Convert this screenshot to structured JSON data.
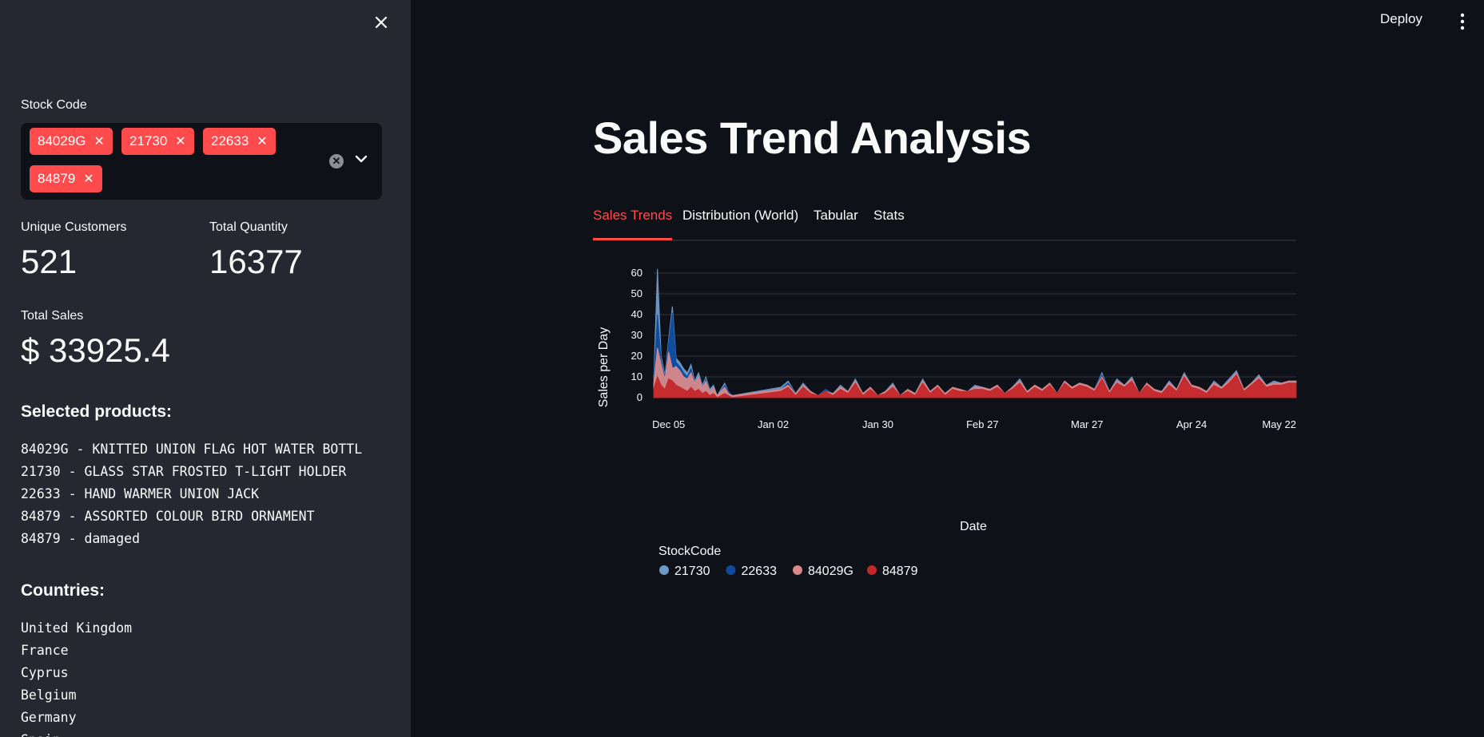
{
  "sidebar": {
    "stock_code_label": "Stock Code",
    "selected_tags": [
      "84029G",
      "21730",
      "22633",
      "84879"
    ],
    "metrics": [
      {
        "label": "Unique Customers",
        "value": "521"
      },
      {
        "label": "Total Quantity",
        "value": "16377"
      },
      {
        "label": "Total Sales",
        "value": "$ 33925.4"
      }
    ],
    "selected_products_heading": "Selected products:",
    "products": [
      "84029G - KNITTED UNION FLAG HOT WATER BOTTL",
      "21730 - GLASS STAR FROSTED T-LIGHT HOLDER",
      "22633 - HAND WARMER UNION JACK",
      "84879 - ASSORTED COLOUR BIRD ORNAMENT",
      "84879 - damaged"
    ],
    "countries_heading": "Countries:",
    "countries": [
      "United Kingdom",
      "France",
      "Cyprus",
      "Belgium",
      "Germany",
      "Spain"
    ]
  },
  "header": {
    "deploy_label": "Deploy"
  },
  "main": {
    "title": "Sales Trend Analysis",
    "tabs": [
      {
        "label": "Sales Trends",
        "active": true
      },
      {
        "label": "Distribution (World)",
        "active": false
      },
      {
        "label": "Tabular",
        "active": false
      },
      {
        "label": "Stats",
        "active": false
      }
    ]
  },
  "colors": {
    "accent": "#ff4b4b",
    "sidebar_bg": "#262730",
    "main_bg": "#0e1117"
  },
  "chart_data": {
    "type": "area",
    "xlabel": "Date",
    "ylabel": "Sales per Day",
    "legend_title": "StockCode",
    "legend_position": "bottom",
    "ylim": [
      0,
      60
    ],
    "y_ticks": [
      0,
      10,
      20,
      30,
      40,
      50,
      60
    ],
    "x_ticks": [
      "Dec 05",
      "Jan 02",
      "Jan 30",
      "Feb 27",
      "Mar 27",
      "Apr 24",
      "May 22"
    ],
    "x_tick_days": [
      0,
      28,
      56,
      84,
      112,
      140,
      168
    ],
    "x_range_days": [
      -4,
      168
    ],
    "grid": true,
    "series": [
      {
        "name": "21730",
        "color": "#6a9ac7",
        "x": [
          -4,
          -3,
          -2,
          -1,
          0,
          1,
          2,
          3,
          4,
          5,
          6,
          7,
          8,
          9,
          10,
          11,
          12,
          13,
          14,
          15,
          16,
          17,
          30,
          32,
          34,
          36,
          38,
          40,
          42,
          44,
          46,
          48,
          50,
          52,
          54,
          56,
          58,
          60,
          62,
          64,
          66,
          68,
          70,
          72,
          74,
          76,
          78,
          80,
          82,
          84,
          86,
          88,
          90,
          92,
          94,
          96,
          98,
          100,
          102,
          104,
          106,
          108,
          110,
          112,
          114,
          116,
          118,
          120,
          122,
          124,
          126,
          128,
          130,
          132,
          134,
          136,
          138,
          140,
          142,
          144,
          146,
          148,
          150,
          152,
          154,
          156,
          158,
          160,
          162,
          164,
          166,
          168
        ],
        "y": [
          9,
          62,
          20,
          11,
          28,
          44,
          19,
          17,
          14,
          12,
          16,
          8,
          12,
          6,
          10,
          4,
          6,
          1,
          4,
          7,
          3,
          1,
          5,
          8,
          2,
          7,
          3,
          1,
          4,
          2,
          6,
          3,
          9,
          2,
          5,
          1,
          3,
          7,
          1,
          4,
          2,
          9,
          3,
          6,
          2,
          5,
          4,
          3,
          6,
          5,
          4,
          6,
          2,
          5,
          9,
          3,
          6,
          4,
          7,
          2,
          8,
          5,
          7,
          6,
          4,
          12,
          3,
          9,
          6,
          10,
          2,
          7,
          4,
          3,
          8,
          4,
          12,
          6,
          5,
          3,
          8,
          5,
          9,
          13,
          4,
          7,
          11,
          6,
          8,
          7,
          8,
          8
        ]
      },
      {
        "name": "22633",
        "color": "#0b4a9e",
        "x": [
          -4,
          -3,
          -2,
          -1,
          0,
          1,
          2,
          3,
          4,
          5,
          6,
          7,
          8,
          9,
          10,
          11,
          12,
          13,
          14,
          15,
          16,
          17,
          30,
          32,
          34,
          36,
          38,
          40,
          42,
          44,
          46,
          48,
          50,
          52,
          54,
          56,
          58,
          60,
          62,
          64,
          66,
          68,
          70,
          72,
          74,
          76,
          78,
          80,
          82,
          84,
          86,
          88,
          90,
          92,
          94,
          96,
          98,
          100,
          102,
          104,
          106,
          108,
          110,
          112,
          114,
          116,
          118,
          120,
          122,
          124,
          126,
          128,
          130,
          132,
          134,
          136,
          138,
          140,
          142,
          144,
          146,
          148,
          150,
          152,
          154,
          156,
          158,
          160,
          162,
          164,
          166,
          168
        ],
        "y": [
          8,
          40,
          18,
          10,
          26,
          41,
          17,
          15,
          12,
          10,
          14,
          7,
          10,
          5,
          9,
          3,
          5,
          1,
          3,
          6,
          3,
          1,
          4,
          7,
          2,
          6,
          3,
          1,
          4,
          2,
          5,
          3,
          8,
          2,
          5,
          1,
          3,
          6,
          1,
          4,
          2,
          8,
          3,
          6,
          2,
          5,
          4,
          3,
          5,
          5,
          4,
          6,
          2,
          5,
          8,
          3,
          6,
          4,
          7,
          2,
          8,
          5,
          7,
          6,
          4,
          11,
          3,
          8,
          6,
          9,
          2,
          7,
          4,
          3,
          7,
          4,
          11,
          6,
          5,
          3,
          7,
          5,
          8,
          12,
          4,
          7,
          10,
          6,
          7,
          7,
          8,
          8
        ]
      },
      {
        "name": "84029G",
        "color": "#d8898a",
        "x": [
          -4,
          -3,
          -2,
          -1,
          0,
          1,
          2,
          3,
          4,
          5,
          6,
          7,
          8,
          9,
          10,
          11,
          12,
          13,
          14,
          15,
          16,
          17,
          30,
          32,
          34,
          36,
          38,
          40,
          42,
          44,
          46,
          48,
          50,
          52,
          54,
          56,
          58,
          60,
          62,
          64,
          66,
          68,
          70,
          72,
          74,
          76,
          78,
          80,
          82,
          84,
          86,
          88,
          90,
          92,
          94,
          96,
          98,
          100,
          102,
          104,
          106,
          108,
          110,
          112,
          114,
          116,
          118,
          120,
          122,
          124,
          126,
          128,
          130,
          132,
          134,
          136,
          138,
          140,
          142,
          144,
          146,
          148,
          150,
          152,
          154,
          156,
          158,
          160,
          162,
          164,
          166,
          168
        ],
        "y": [
          7,
          24,
          16,
          9,
          22,
          14,
          15,
          13,
          10,
          9,
          12,
          7,
          10,
          5,
          8,
          3,
          5,
          1,
          3,
          5,
          2,
          1,
          4,
          6,
          2,
          6,
          3,
          1,
          3,
          2,
          5,
          3,
          8,
          2,
          5,
          1,
          3,
          6,
          1,
          4,
          2,
          8,
          3,
          6,
          2,
          5,
          4,
          3,
          5,
          5,
          4,
          6,
          2,
          5,
          8,
          3,
          6,
          4,
          7,
          2,
          8,
          5,
          7,
          6,
          4,
          10,
          3,
          8,
          6,
          9,
          2,
          7,
          4,
          3,
          7,
          4,
          11,
          6,
          5,
          3,
          7,
          5,
          8,
          12,
          4,
          7,
          10,
          6,
          7,
          7,
          8,
          8
        ]
      },
      {
        "name": "84879",
        "color": "#c4272a",
        "x": [
          -4,
          -3,
          -2,
          -1,
          0,
          1,
          2,
          3,
          4,
          5,
          6,
          7,
          8,
          9,
          10,
          11,
          12,
          13,
          14,
          15,
          16,
          17,
          30,
          32,
          34,
          36,
          38,
          40,
          42,
          44,
          46,
          48,
          50,
          52,
          54,
          56,
          58,
          60,
          62,
          64,
          66,
          68,
          70,
          72,
          74,
          76,
          78,
          80,
          82,
          84,
          86,
          88,
          90,
          92,
          94,
          96,
          98,
          100,
          102,
          104,
          106,
          108,
          110,
          112,
          114,
          116,
          118,
          120,
          122,
          124,
          126,
          128,
          130,
          132,
          134,
          136,
          138,
          140,
          142,
          144,
          146,
          148,
          150,
          152,
          154,
          156,
          158,
          160,
          162,
          164,
          166,
          168
        ],
        "y": [
          4,
          10,
          6,
          4,
          9,
          8,
          6,
          5,
          4,
          3,
          5,
          3,
          4,
          2,
          3,
          1,
          2,
          0,
          1,
          2,
          1,
          0,
          3,
          5,
          1,
          5,
          2,
          1,
          3,
          1,
          4,
          2,
          7,
          1,
          4,
          1,
          2,
          5,
          1,
          3,
          1,
          7,
          2,
          5,
          1,
          4,
          3,
          3,
          4,
          4,
          3,
          5,
          2,
          4,
          7,
          2,
          5,
          3,
          6,
          2,
          7,
          4,
          6,
          5,
          3,
          9,
          2,
          7,
          5,
          8,
          2,
          6,
          3,
          2,
          6,
          3,
          10,
          5,
          4,
          2,
          6,
          4,
          7,
          11,
          3,
          6,
          9,
          5,
          6,
          6,
          7,
          7
        ]
      }
    ]
  }
}
